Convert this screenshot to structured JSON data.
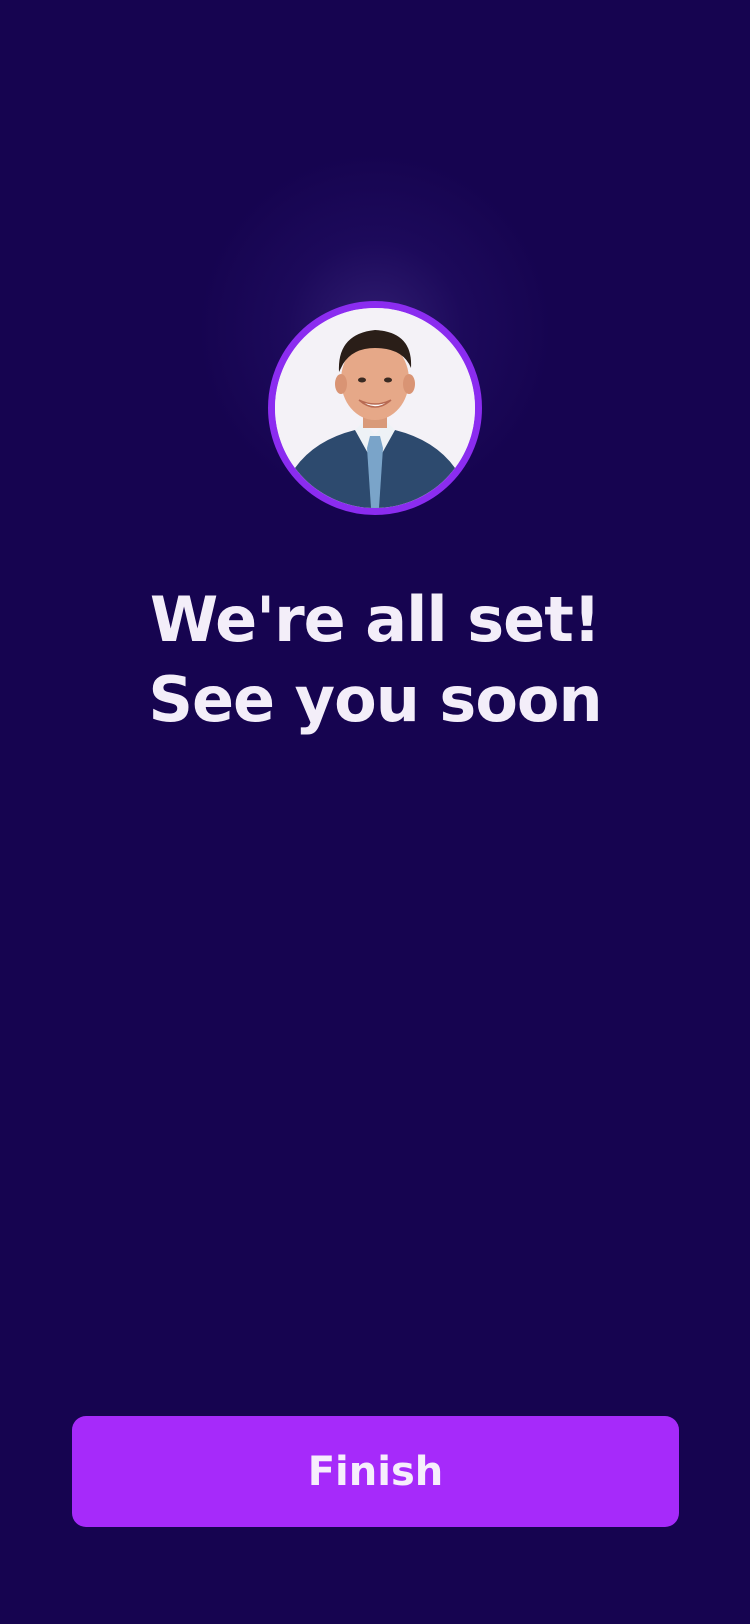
{
  "screen": {
    "background_color": "#160450",
    "accent_color": "#a62afa"
  },
  "avatar": {
    "icon": "profile-photo",
    "ring_color": "#8b2cf0"
  },
  "headline": {
    "line1": "We're all set!",
    "line2": "See you soon"
  },
  "finish_button": {
    "label": "Finish"
  }
}
